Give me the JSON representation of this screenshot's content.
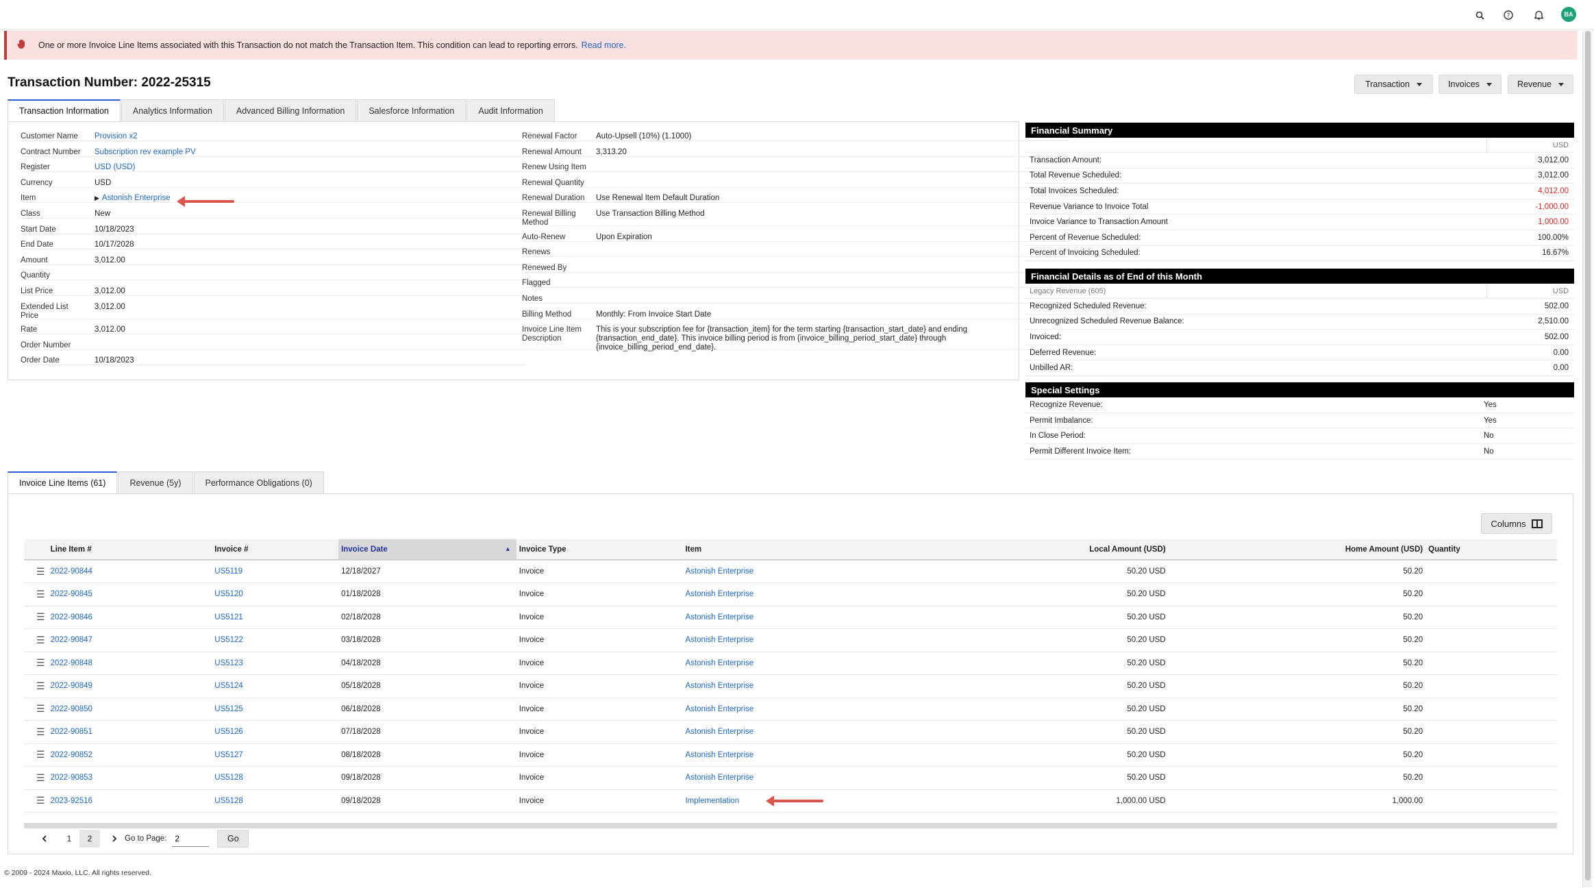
{
  "topbar": {
    "icons": [
      "search-icon",
      "help-icon",
      "bell-icon"
    ],
    "avatar_initials": "BA"
  },
  "alert": {
    "message": "One or more Invoice Line Items associated with this Transaction do not match the Transaction Item. This condition can lead to reporting errors.",
    "link": "Read more."
  },
  "page_title": "Transaction Number: 2022-25315",
  "actions": {
    "transaction": "Transaction",
    "invoices": "Invoices",
    "revenue": "Revenue"
  },
  "tabs": [
    "Transaction Information",
    "Analytics Information",
    "Advanced Billing Information",
    "Salesforce Information",
    "Audit Information"
  ],
  "info_left": [
    {
      "label": "Customer Name",
      "value": "Provision x2",
      "link": true
    },
    {
      "label": "Contract Number",
      "value": "Subscription rev example PV",
      "link": true
    },
    {
      "label": "Register",
      "value": "USD (USD)",
      "link": true
    },
    {
      "label": "Currency",
      "value": "USD"
    },
    {
      "label": "Item",
      "value": "Astonish Enterprise",
      "link": true
    },
    {
      "label": "Class",
      "value": "New"
    },
    {
      "label": "Start Date",
      "value": "10/18/2023"
    },
    {
      "label": "End Date",
      "value": "10/17/2028"
    },
    {
      "label": "Amount",
      "value": "3,012.00"
    },
    {
      "label": "Quantity",
      "value": ""
    },
    {
      "label": "List Price",
      "value": "3,012.00"
    },
    {
      "label": "Extended List",
      "label2": "Price",
      "value": "3,012.00"
    },
    {
      "label": "Rate",
      "value": "3,012.00"
    },
    {
      "label": "Order Number",
      "value": ""
    },
    {
      "label": "Order Date",
      "value": "10/18/2023"
    }
  ],
  "info_right": [
    {
      "label": "Renewal Factor",
      "value": "Auto-Upsell (10%) (1.1000)"
    },
    {
      "label": "Renewal Amount",
      "value": "3,313.20"
    },
    {
      "label": "Renew Using Item",
      "value": ""
    },
    {
      "label": "Renewal Quantity",
      "value": ""
    },
    {
      "label": "Renewal Duration",
      "value": "Use Renewal Item Default Duration"
    },
    {
      "label": "Renewal Billing",
      "label2": "Method",
      "value": "Use Transaction Billing Method"
    },
    {
      "label": "Auto-Renew",
      "value": "Upon Expiration"
    },
    {
      "label": "Renews",
      "value": ""
    },
    {
      "label": "Renewed By",
      "value": ""
    },
    {
      "label": "Flagged",
      "value": ""
    },
    {
      "label": "Notes",
      "value": ""
    },
    {
      "label": "Billing Method",
      "value": "Monthly: From Invoice Start Date"
    },
    {
      "label": "Invoice Line Item",
      "label2": "Description",
      "value": "This is your subscription fee for {transaction_item} for the term starting {transaction_start_date} and ending",
      "value2": "{transaction_end_date}. This invoice billing period is from {invoice_billing_period_start_date} through",
      "value3": "{invoice_billing_period_end_date}."
    }
  ],
  "financial_summary": {
    "title": "Financial Summary",
    "currency": "USD",
    "rows": [
      {
        "label": "Transaction Amount:",
        "value": "3,012.00"
      },
      {
        "label": "Total Revenue Scheduled:",
        "value": "3,012.00"
      },
      {
        "label": "Total Invoices Scheduled:",
        "value": "4,012.00",
        "red": true
      },
      {
        "label": "Revenue Variance to Invoice Total",
        "value": "-1,000.00",
        "red": true
      },
      {
        "label": "Invoice Variance to Transaction Amount",
        "value": "1,000.00",
        "red": true
      },
      {
        "label": "Percent of Revenue Scheduled:",
        "value": "100.00%"
      },
      {
        "label": "Percent of Invoicing Scheduled:",
        "value": "16.67%"
      }
    ]
  },
  "financial_details": {
    "title": "Financial Details as of End of this Month",
    "subheader": "Legacy Revenue (605)",
    "currency": "USD",
    "rows": [
      {
        "label": "Recognized Scheduled Revenue:",
        "value": "502.00"
      },
      {
        "label": "Unrecognized Scheduled Revenue Balance:",
        "value": "2,510.00"
      },
      {
        "label": "Invoiced:",
        "value": "502.00"
      },
      {
        "label": "Deferred Revenue:",
        "value": "0.00"
      },
      {
        "label": "Unbilled AR:",
        "value": "0.00"
      }
    ]
  },
  "special_settings": {
    "title": "Special Settings",
    "rows": [
      {
        "label": "Recognize Revenue:",
        "value": "Yes"
      },
      {
        "label": "Permit Imbalance:",
        "value": "Yes"
      },
      {
        "label": "In Close Period:",
        "value": "No"
      },
      {
        "label": "Permit Different Invoice Item:",
        "value": "No"
      }
    ]
  },
  "bottom_tabs": [
    "Invoice Line Items (61)",
    "Revenue (5y)",
    "Performance Obligations (0)"
  ],
  "columns_button": "Columns",
  "table": {
    "headers": [
      "Line Item #",
      "Invoice #",
      "Invoice Date",
      "Invoice Type",
      "Item",
      "Local Amount (USD)",
      "Home Amount (USD)",
      "Quantity"
    ],
    "rows": [
      {
        "line": "2022-90844",
        "invoice": "US5119",
        "date": "12/18/2027",
        "type": "Invoice",
        "item": "Astonish Enterprise",
        "local": "50.20 USD",
        "home": "50.20",
        "qty": ""
      },
      {
        "line": "2022-90845",
        "invoice": "US5120",
        "date": "01/18/2028",
        "type": "Invoice",
        "item": "Astonish Enterprise",
        "local": "50.20 USD",
        "home": "50.20",
        "qty": ""
      },
      {
        "line": "2022-90846",
        "invoice": "US5121",
        "date": "02/18/2028",
        "type": "Invoice",
        "item": "Astonish Enterprise",
        "local": "50.20 USD",
        "home": "50.20",
        "qty": ""
      },
      {
        "line": "2022-90847",
        "invoice": "US5122",
        "date": "03/18/2028",
        "type": "Invoice",
        "item": "Astonish Enterprise",
        "local": "50.20 USD",
        "home": "50.20",
        "qty": ""
      },
      {
        "line": "2022-90848",
        "invoice": "US5123",
        "date": "04/18/2028",
        "type": "Invoice",
        "item": "Astonish Enterprise",
        "local": "50.20 USD",
        "home": "50.20",
        "qty": ""
      },
      {
        "line": "2022-90849",
        "invoice": "US5124",
        "date": "05/18/2028",
        "type": "Invoice",
        "item": "Astonish Enterprise",
        "local": "50.20 USD",
        "home": "50.20",
        "qty": ""
      },
      {
        "line": "2022-90850",
        "invoice": "US5125",
        "date": "06/18/2028",
        "type": "Invoice",
        "item": "Astonish Enterprise",
        "local": "50.20 USD",
        "home": "50.20",
        "qty": ""
      },
      {
        "line": "2022-90851",
        "invoice": "US5126",
        "date": "07/18/2028",
        "type": "Invoice",
        "item": "Astonish Enterprise",
        "local": "50.20 USD",
        "home": "50.20",
        "qty": ""
      },
      {
        "line": "2022-90852",
        "invoice": "US5127",
        "date": "08/18/2028",
        "type": "Invoice",
        "item": "Astonish Enterprise",
        "local": "50.20 USD",
        "home": "50.20",
        "qty": ""
      },
      {
        "line": "2022-90853",
        "invoice": "US5128",
        "date": "09/18/2028",
        "type": "Invoice",
        "item": "Astonish Enterprise",
        "local": "50.20 USD",
        "home": "50.20",
        "qty": ""
      },
      {
        "line": "2023-92516",
        "invoice": "US5128",
        "date": "09/18/2028",
        "type": "Invoice",
        "item": "Implementation",
        "local": "1,000.00 USD",
        "home": "1,000.00",
        "qty": ""
      }
    ]
  },
  "pager": {
    "pages": [
      "1",
      "2"
    ],
    "current": "2",
    "goto_label": "Go to Page:",
    "goto_value": "2",
    "go_label": "Go"
  },
  "footer": "© 2009 - 2024 Maxio, LLC. All rights reserved.",
  "colors": {
    "link": "#1a66c8",
    "alert_bg": "#fbe0e2",
    "negative": "#e0251f",
    "tab_active": "#2d5bd4",
    "annotation_arrow": "#d9564a"
  }
}
